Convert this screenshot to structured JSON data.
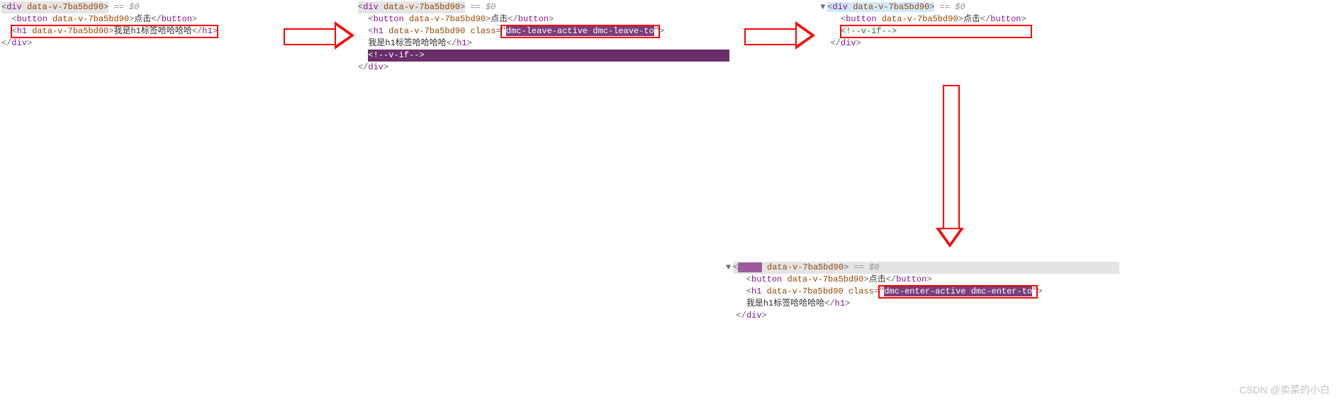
{
  "common": {
    "div_open": "<div ",
    "div_close": "</div>",
    "button_open": "<button ",
    "button_close": "</button>",
    "h1_open": "<h1 ",
    "h1_close": "</h1>",
    "attr_data_v": "data-v-7ba5bd90",
    "class_attr": "class",
    "eq_dollar": " == $0",
    "button_text": "点击",
    "h1_text": "我是h1标签哈哈哈哈",
    "v_if_comment": "<!--v-if-->"
  },
  "panel1": {
    "class_value": ""
  },
  "panel2": {
    "class_value": "dmc-leave-active dmc-leave-to"
  },
  "panel4": {
    "class_value": "dmc-enter-active dmc-enter-to"
  },
  "watermark": "CSDN @卖菜的小白"
}
